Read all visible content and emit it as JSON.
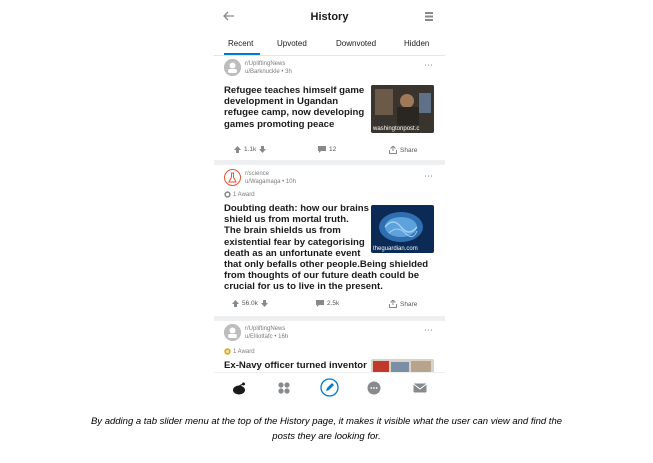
{
  "header": {
    "title": "History"
  },
  "tabs": [
    {
      "label": "Recent"
    },
    {
      "label": "Upvoted"
    },
    {
      "label": "Downvoted"
    },
    {
      "label": "Hidden"
    }
  ],
  "posts": [
    {
      "subreddit": "r/UpliftingNews",
      "user_meta": "u/Barknuckle • 3h",
      "title_lines": [
        "Refugee teaches himself game",
        "development in Ugandan",
        "refugee camp, now developing",
        "games promoting peace"
      ],
      "thumb_label": "washingtonpost.c",
      "upvotes": "1.1k",
      "comments": "12",
      "share": "Share"
    },
    {
      "subreddit": "r/science",
      "user_meta": "u/Wagamaga • 10h",
      "award": "1 Award",
      "title_lines": [
        "Doubting death: how our brains",
        "shield us from mortal truth.",
        "The brain shields us from",
        "existential fear by categorising",
        "death as an unfortunate event",
        "that only befalls other people.Being shielded",
        "from thoughts of our future death could be",
        "crucial for us to live in the present."
      ],
      "thumb_label": "theguardian.com",
      "upvotes": "56.0k",
      "comments": "2.5k",
      "share": "Share"
    },
    {
      "subreddit": "r/UpliftingNews",
      "user_meta": "u/Elliottafc • 16h",
      "award": "1 Award",
      "title_lines": [
        "Ex-Navy officer turned inventor"
      ]
    }
  ],
  "caption": {
    "line1": "By adding a tab slider menu at the top of the History page, it makes it visible what the user can view and find the",
    "line2": "posts they are looking for."
  },
  "colors": {
    "accent": "#0079d3",
    "text": "#1a1a1b",
    "muted": "#7c7c7c"
  }
}
